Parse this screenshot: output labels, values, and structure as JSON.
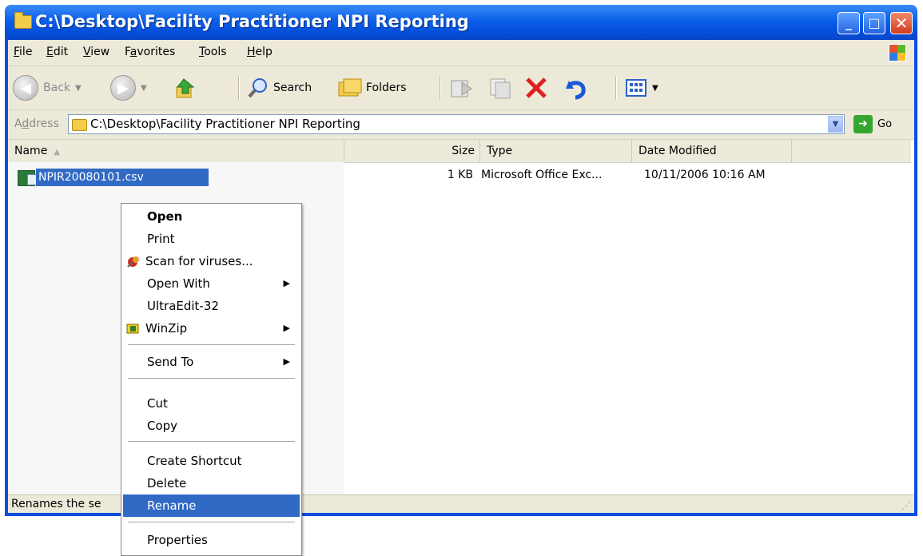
{
  "window": {
    "title": "C:\\Desktop\\Facility Practitioner NPI Reporting",
    "minimize": "_",
    "maximize": "□",
    "close": "✕"
  },
  "menubar": {
    "items": [
      {
        "label": "File",
        "underline": "F",
        "rest": "ile"
      },
      {
        "label": "Edit",
        "underline": "E",
        "rest": "dit"
      },
      {
        "label": "View",
        "underline": "V",
        "rest": "iew"
      },
      {
        "label": "Favorites",
        "pre": "F",
        "underline": "a",
        "rest": "vorites"
      },
      {
        "label": "Tools",
        "underline": "T",
        "rest": "ools"
      },
      {
        "label": "Help",
        "underline": "H",
        "rest": "elp"
      }
    ]
  },
  "toolbar": {
    "back_label": "Back",
    "search_label": "Search",
    "folders_label": "Folders"
  },
  "address": {
    "label_pre": "A",
    "label_underline": "d",
    "label_rest": "dress",
    "value": "C:\\Desktop\\Facility Practitioner NPI Reporting",
    "go_label": "Go"
  },
  "columns": {
    "name": "Name",
    "size": "Size",
    "type": "Type",
    "date": "Date Modified"
  },
  "files": [
    {
      "name": "NPIR20080101.csv",
      "size": "1 KB",
      "type": "Microsoft Office Exc...",
      "date": "10/11/2006 10:16 AM"
    }
  ],
  "context_menu": {
    "open": "Open",
    "print": "Print",
    "scan": "Scan for viruses...",
    "open_with": "Open With",
    "ultraedit": "UltraEdit-32",
    "winzip": "WinZip",
    "send_to": "Send To",
    "cut": "Cut",
    "copy": "Copy",
    "create_shortcut": "Create Shortcut",
    "delete": "Delete",
    "rename": "Rename",
    "properties": "Properties"
  },
  "status": {
    "text": "Renames the se"
  },
  "colors": {
    "titlebar": "#0a5fe8",
    "selection": "#316ac5",
    "chrome": "#ece9d8"
  }
}
